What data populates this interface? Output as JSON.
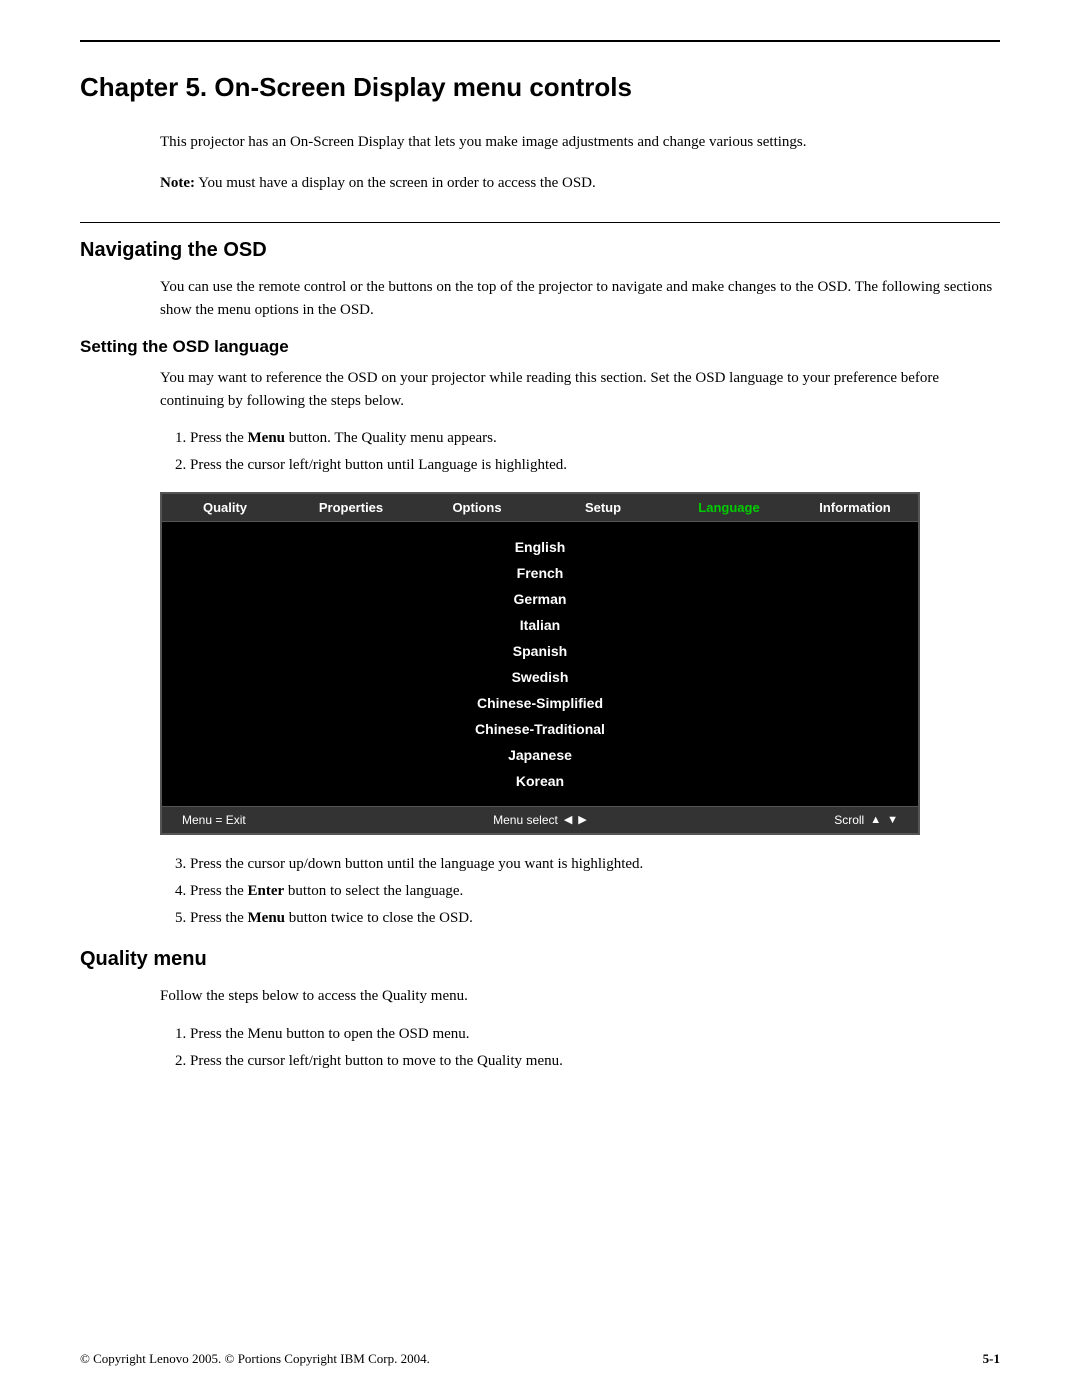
{
  "page": {
    "top_rule": true,
    "chapter_title": "Chapter 5. On-Screen Display menu controls",
    "intro_text": "This projector has an On-Screen Display that lets you make image adjustments and change various settings.",
    "note_label": "Note:",
    "note_text": "You must have a display on the screen in order to access the OSD.",
    "section_navigating_title": "Navigating the OSD",
    "navigating_body": "You can use the remote control or the buttons on the top of the projector to navigate and make changes to the OSD. The following sections show the menu options in the OSD.",
    "subsection_language_title": "Setting the OSD language",
    "language_body": "You may want to reference the OSD on your projector while reading this section. Set the OSD language to your preference before continuing by following the steps below.",
    "language_steps": [
      "Press the Menu button. The Quality menu appears.",
      "Press the cursor left/right button until Language is highlighted."
    ],
    "osd": {
      "menu_items": [
        "Quality",
        "Properties",
        "Options",
        "Setup",
        "Language",
        "Information"
      ],
      "active_item": "Language",
      "languages": [
        "English",
        "French",
        "German",
        "Italian",
        "Spanish",
        "Swedish",
        "Chinese-Simplified",
        "Chinese-Traditional",
        "Japanese",
        "Korean"
      ],
      "footer_left": "Menu = Exit",
      "footer_center_label": "Menu select",
      "footer_right": "Scroll"
    },
    "language_steps_after": [
      "Press the cursor up/down button until the language you want is highlighted.",
      "Press the Enter button to select the language.",
      "Press the Menu button twice to close the OSD."
    ],
    "section_quality_title": "Quality menu",
    "quality_intro": "Follow the steps below to access the Quality menu.",
    "quality_steps": [
      "Press the Menu button to open the OSD menu.",
      "Press the cursor left/right button to move to the Quality menu."
    ],
    "footer": {
      "copyright": "© Copyright Lenovo 2005. © Portions Copyright IBM Corp. 2004.",
      "page_number": "5-1"
    }
  }
}
